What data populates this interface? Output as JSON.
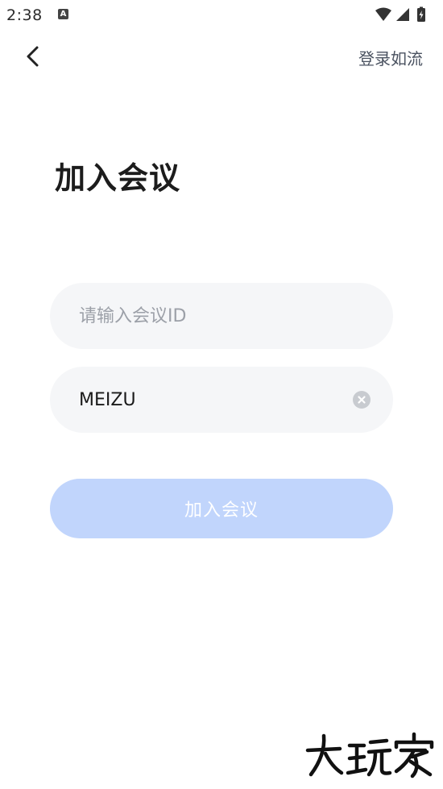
{
  "status_bar": {
    "time": "2:38",
    "notification_glyph": "A",
    "icons": [
      "wifi-icon",
      "signal-icon",
      "battery-charging-icon"
    ]
  },
  "nav": {
    "back_icon": "chevron-left-icon",
    "login_label": "登录如流"
  },
  "page": {
    "title": "加入会议"
  },
  "form": {
    "meeting_id": {
      "value": "",
      "placeholder": "请输入会议ID"
    },
    "display_name": {
      "value": "MEIZU",
      "placeholder": ""
    },
    "clear_icon": "clear-circle-icon",
    "join_label": "加入会议"
  },
  "colors": {
    "input_bg": "#f5f6f8",
    "button_disabled_bg": "#c1d5fc",
    "title": "#1c1c1c",
    "link": "#4a5260",
    "placeholder": "#9ca0a8"
  },
  "watermark": {
    "text": "大玩家"
  }
}
